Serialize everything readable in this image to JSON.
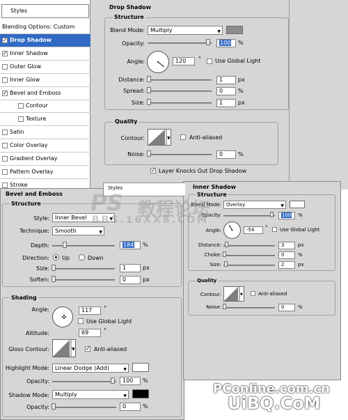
{
  "styles_list": {
    "header": "Styles",
    "items": [
      {
        "label": "Blending Options: Custom",
        "checkbox": false,
        "checked": false,
        "selected": false,
        "sub": false
      },
      {
        "label": "Drop Shadow",
        "checkbox": true,
        "checked": true,
        "selected": true,
        "sub": false
      },
      {
        "label": "Inner Shadow",
        "checkbox": true,
        "checked": true,
        "selected": false,
        "sub": false
      },
      {
        "label": "Outer Glow",
        "checkbox": true,
        "checked": false,
        "selected": false,
        "sub": false
      },
      {
        "label": "Inner Glow",
        "checkbox": true,
        "checked": false,
        "selected": false,
        "sub": false
      },
      {
        "label": "Bevel and Emboss",
        "checkbox": true,
        "checked": true,
        "selected": false,
        "sub": false
      },
      {
        "label": "Contour",
        "checkbox": true,
        "checked": false,
        "selected": false,
        "sub": true
      },
      {
        "label": "Texture",
        "checkbox": true,
        "checked": false,
        "selected": false,
        "sub": true
      },
      {
        "label": "Satin",
        "checkbox": true,
        "checked": false,
        "selected": false,
        "sub": false
      },
      {
        "label": "Color Overlay",
        "checkbox": true,
        "checked": false,
        "selected": false,
        "sub": false
      },
      {
        "label": "Gradient Overlay",
        "checkbox": true,
        "checked": false,
        "selected": false,
        "sub": false
      },
      {
        "label": "Pattern Overlay",
        "checkbox": true,
        "checked": false,
        "selected": false,
        "sub": false
      },
      {
        "label": "Stroke",
        "checkbox": true,
        "checked": false,
        "selected": false,
        "sub": false
      }
    ]
  },
  "drop_shadow": {
    "title": "Drop Shadow",
    "structure_title": "Structure",
    "blend_mode_label": "Blend Mode:",
    "blend_mode": "Multiply",
    "blend_color": "#8c8c8c",
    "opacity_label": "Opacity:",
    "opacity": "100",
    "opacity_unit": "%",
    "angle_label": "Angle:",
    "angle": "120",
    "angle_unit": "°",
    "use_global_light": "Use Global Light",
    "use_global_light_checked": false,
    "distance_label": "Distance:",
    "distance": "1",
    "spread_label": "Spread:",
    "spread": "0",
    "size_label": "Size:",
    "size": "1",
    "px": "px",
    "percent": "%",
    "quality_title": "Quality",
    "contour_label": "Contour:",
    "anti_aliased": "Anti-aliased",
    "noise_label": "Noise:",
    "noise": "0",
    "layer_knocks_out": "Layer Knocks Out Drop Shadow",
    "layer_knocks_out_checked": true
  },
  "bevel": {
    "title": "Bevel and Emboss",
    "structure_title": "Structure",
    "style_label": "Style:",
    "style": "Inner Bevel",
    "technique_label": "Technique:",
    "technique": "Smooth",
    "depth_label": "Depth:",
    "depth": "184",
    "direction_label": "Direction:",
    "dir_up": "Up",
    "dir_down": "Down",
    "size_label": "Size:",
    "size": "1",
    "soften_label": "Soften:",
    "soften": "0",
    "px": "px",
    "percent": "%",
    "shading_title": "Shading",
    "angle_label": "Angle:",
    "angle": "117",
    "deg": "°",
    "use_global_light": "Use Global Light",
    "altitude_label": "Altitude:",
    "altitude": "69",
    "gloss_label": "Gloss Contour:",
    "anti_aliased": "Anti-aliased",
    "highlight_mode_label": "Highlight Mode:",
    "highlight_mode": "Linear Dodge (Add)",
    "highlight_color": "#ffffff",
    "hl_opacity_label": "Opacity:",
    "hl_opacity": "100",
    "shadow_mode_label": "Shadow Mode:",
    "shadow_mode": "Multiply",
    "shadow_color": "#000000",
    "sh_opacity_label": "Opacity:",
    "sh_opacity": "0"
  },
  "inner_shadow": {
    "styles_tab": "Styles",
    "title": "Inner Shadow",
    "structure_title": "Structure",
    "blend_mode_label": "Blend Mode:",
    "blend_mode": "Overlay",
    "blend_color": "#ffffff",
    "opacity_label": "Opacity:",
    "opacity": "100",
    "angle_label": "Angle:",
    "angle": "-54",
    "deg": "°",
    "use_global_light": "Use Global Light",
    "distance_label": "Distance:",
    "distance": "3",
    "choke_label": "Choke:",
    "choke": "0",
    "size_label": "Size:",
    "size": "2",
    "px": "px",
    "percent": "%",
    "quality_title": "Quality",
    "contour_label": "Contour:",
    "anti_aliased": "Anti-aliased",
    "noise_label": "Noise:",
    "noise": "0"
  },
  "watermarks": {
    "ps_main": "PS",
    "ps_cjk": "教程论坛",
    "bbs": "BBS.16XX8.COM",
    "pconline": "PConline.com.cn",
    "uibq": "UiBQ.CoM"
  }
}
